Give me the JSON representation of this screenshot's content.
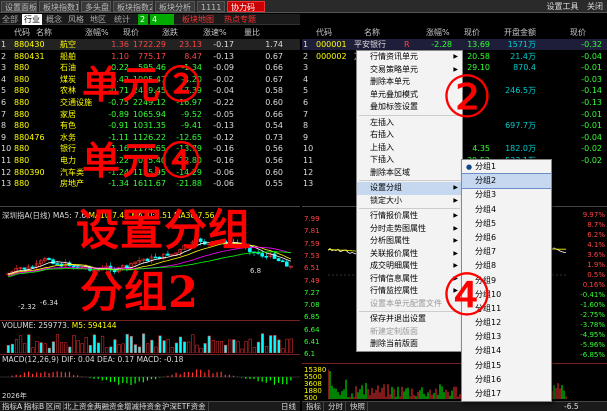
{
  "top_tabs": [
    "设置面板",
    "板块指数1",
    "多头盘",
    "板块指数2",
    "板块分析",
    "1111",
    "协力码"
  ],
  "top_right": [
    "设置工具",
    "关闭"
  ],
  "left_panel": {
    "tabs": [
      "全部",
      "行业",
      "概念",
      "风格",
      "地区",
      "统计"
    ],
    "selected_count": "2",
    "tab_extra": "4",
    "tab_map": "板块地图",
    "tab_hot": "热点专题",
    "headers": [
      "代码",
      "名称",
      "涨幅%",
      "现价",
      "涨跌",
      "涨速%",
      "量比"
    ],
    "rows": [
      {
        "idx": "1",
        "code": "880430",
        "name": "航空",
        "chg": "1.36",
        "price": "1722.29",
        "diff": "23.13",
        "speed": "-0.17",
        "vr": "1.74"
      },
      {
        "idx": "2",
        "code": "880431",
        "name": "船舶",
        "chg": "1.10",
        "price": "775.17",
        "diff": "8.47",
        "speed": "-0.13",
        "vr": "0.67"
      },
      {
        "idx": "3",
        "code": "880",
        "name": "石油",
        "chg": "-0.22",
        "price": "595.46",
        "diff": "-1.34",
        "speed": "-0.09",
        "vr": "0.66"
      },
      {
        "idx": "4",
        "code": "880",
        "name": "煤炭",
        "chg": "-0.42",
        "price": "1005.47",
        "diff": "-4.20",
        "speed": "-0.02",
        "vr": "0.67"
      },
      {
        "idx": "5",
        "code": "880",
        "name": "农林",
        "chg": "-0.71",
        "price": "2449.45",
        "diff": "-17.39",
        "speed": "-0.04",
        "vr": "0.58"
      },
      {
        "idx": "6",
        "code": "880",
        "name": "交通设施",
        "chg": "-0.75",
        "price": "2249.12",
        "diff": "-16.97",
        "speed": "-0.22",
        "vr": "0.60"
      },
      {
        "idx": "7",
        "code": "880",
        "name": "家居",
        "chg": "-0.89",
        "price": "1065.94",
        "diff": "-9.52",
        "speed": "-0.05",
        "vr": "0.66"
      },
      {
        "idx": "8",
        "code": "880",
        "name": "有色",
        "chg": "-0.91",
        "price": "1031.35",
        "diff": "-9.41",
        "speed": "-0.13",
        "vr": "0.54"
      },
      {
        "idx": "9",
        "code": "880476",
        "name": "水务",
        "chg": "-1.11",
        "price": "1126.22",
        "diff": "-12.65",
        "speed": "-0.12",
        "vr": "0.73"
      },
      {
        "idx": "10",
        "code": "880",
        "name": "银行",
        "chg": "-1.16",
        "price": "1174.65",
        "diff": "-13.79",
        "speed": "-0.16",
        "vr": "0.56"
      },
      {
        "idx": "11",
        "code": "880",
        "name": "电力",
        "chg": "-1.22",
        "price": "1035.40",
        "diff": "-12.80",
        "speed": "-0.16",
        "vr": "0.56"
      },
      {
        "idx": "12",
        "code": "880390",
        "name": "汽车类",
        "chg": "-1.24",
        "price": "1135.95",
        "diff": "-14.29",
        "speed": "-0.06",
        "vr": "0.60"
      },
      {
        "idx": "13",
        "code": "880",
        "name": "房地产",
        "chg": "-1.34",
        "price": "1611.67",
        "diff": "-21.88",
        "speed": "-0.06",
        "vr": "0.55"
      }
    ]
  },
  "right_panel": {
    "headers": [
      "代码",
      "名称",
      "",
      "涨幅%",
      "现价",
      "开盘金额",
      "现价"
    ],
    "rows": [
      {
        "idx": "1",
        "code": "000001",
        "name": "平安银行",
        "flag": "R",
        "chg": "-2.28",
        "price": "13.69",
        "amount": "1571万",
        "last": "-0.32"
      },
      {
        "idx": "2",
        "code": "000002",
        "name": "万科A",
        "flag": "",
        "chg": "-0.21",
        "price": "20.58",
        "amount": "21.4万",
        "last": "-0.04"
      },
      {
        "idx": "3",
        "code": "",
        "name": "",
        "flag": "",
        "chg": "",
        "price": "29.10",
        "amount": "870.4",
        "last": "-0.01"
      },
      {
        "idx": "4",
        "code": "",
        "name": "",
        "flag": "",
        "chg": "",
        "price": "",
        "amount": "",
        "last": "-0.03"
      },
      {
        "idx": "5",
        "code": "",
        "name": "",
        "flag": "",
        "chg": "",
        "price": "",
        "amount": "246.5万",
        "last": "-0.14"
      },
      {
        "idx": "6",
        "code": "",
        "name": "",
        "flag": "",
        "chg": "",
        "price": "",
        "amount": "",
        "last": "-0.13"
      },
      {
        "idx": "7",
        "code": "",
        "name": "",
        "flag": "",
        "chg": "",
        "price": "",
        "amount": "",
        "last": "-0.01"
      },
      {
        "idx": "8",
        "code": "",
        "name": "",
        "flag": "",
        "chg": "",
        "price": "",
        "amount": "697.7万",
        "last": "-0.01"
      },
      {
        "idx": "9",
        "code": "",
        "name": "",
        "flag": "",
        "chg": "",
        "price": "",
        "amount": "",
        "last": "-0.04"
      },
      {
        "idx": "10",
        "code": "",
        "name": "",
        "flag": "",
        "chg": "",
        "price": "4.35",
        "amount": "182.0万",
        "last": "-0.02"
      },
      {
        "idx": "11",
        "code": "",
        "name": "",
        "flag": "",
        "chg": "",
        "price": "29.52",
        "amount": "533.1万",
        "last": "-0.02"
      },
      {
        "idx": "12",
        "code": "",
        "name": "",
        "flag": "",
        "chg": "",
        "price": "",
        "amount": "",
        "last": ""
      },
      {
        "idx": "13",
        "code": "",
        "name": "",
        "flag": "",
        "chg": "",
        "price": "",
        "amount": "",
        "last": ""
      }
    ]
  },
  "left_chart": {
    "title": "深圳指A(日线)",
    "ma_label": "MA5:",
    "ma_val": "7.6",
    "ma_more": "MA10:7.49 MA20:7.51 MA30:7.56",
    "price_labels": [
      "-2.32",
      "-6.34",
      "6.8"
    ],
    "volume_label": "VOLUME: 259773.",
    "volume_more": "M5: 594144",
    "macd_label": "MACD(12,26,9) DIF: 0.04 DEA: 0.17 MACD: -0.18",
    "date": "2026年",
    "bottom_tabs": [
      "指标A",
      "指标B",
      "区间",
      "北上资金",
      "两融资金",
      "增减持资金",
      "沪深ETF资金"
    ],
    "bottom_right": "日线"
  },
  "right_chart": {
    "y_left": [
      "7.99",
      "7.81",
      "7.59",
      "7.53",
      "6.51",
      "7.49",
      "7.27",
      "7.08",
      "6.85",
      "6.64",
      "6.41",
      "6.1"
    ],
    "y_right": [
      "9.97%",
      "8.7%",
      "6.2%",
      "4.1%",
      "3.6%",
      "1.9%",
      "0.5%",
      "0.16%",
      "-0.41%",
      "-1.60%",
      "-2.75%",
      "-3.78%",
      "-4.95%",
      "-5.96%",
      "-6.85%"
    ],
    "vol_labels": [
      "15380",
      "5500",
      "3608",
      "1880",
      "500"
    ],
    "bottom_tabs": [
      "指标",
      "分时",
      "快照"
    ],
    "bottom_time": "-6.5"
  },
  "context_menu": {
    "items": [
      {
        "label": "行情资讯单元",
        "arrow": true,
        "disabled": false
      },
      {
        "label": "交易策略单元",
        "arrow": true,
        "disabled": false
      },
      {
        "label": "删除本单元",
        "arrow": false,
        "disabled": false
      },
      {
        "label": "单元叠加模式",
        "arrow": false,
        "disabled": false
      },
      {
        "label": "叠加标签设置",
        "arrow": false,
        "disabled": false
      },
      {
        "sep": true
      },
      {
        "label": "左插入",
        "arrow": false,
        "disabled": false
      },
      {
        "label": "右插入",
        "arrow": false,
        "disabled": false
      },
      {
        "label": "上插入",
        "arrow": false,
        "disabled": false
      },
      {
        "label": "下插入",
        "arrow": false,
        "disabled": false
      },
      {
        "label": "删除本区域",
        "arrow": false,
        "disabled": false
      },
      {
        "sep": true
      },
      {
        "label": "设置分组",
        "arrow": true,
        "disabled": false,
        "selected": true
      },
      {
        "label": "锁定大小",
        "arrow": true,
        "disabled": false
      },
      {
        "sep": true
      },
      {
        "label": "行情报价属性",
        "arrow": true,
        "disabled": false
      },
      {
        "label": "分时走势图属性",
        "arrow": true,
        "disabled": false
      },
      {
        "label": "分析图属性",
        "arrow": true,
        "disabled": false
      },
      {
        "label": "关联报价属性",
        "arrow": true,
        "disabled": false
      },
      {
        "label": "成交明细属性",
        "arrow": true,
        "disabled": false
      },
      {
        "label": "行情信息属性",
        "arrow": true,
        "disabled": false
      },
      {
        "label": "行情监控属性",
        "arrow": true,
        "disabled": false
      },
      {
        "label": "设置本单元配置文件",
        "arrow": false,
        "disabled": true
      },
      {
        "sep": true
      },
      {
        "label": "保存并退出设置",
        "arrow": false,
        "disabled": false
      },
      {
        "label": "新建定制版面",
        "arrow": false,
        "disabled": true
      },
      {
        "label": "删除当前版面",
        "arrow": false,
        "disabled": false
      }
    ]
  },
  "submenu": {
    "items": [
      "分组1",
      "分组2",
      "分组3",
      "分组4",
      "分组5",
      "分组6",
      "分组7",
      "分组8",
      "分组9",
      "分组10",
      "分组11",
      "分组12",
      "分组13",
      "分组14",
      "分组15",
      "分组16",
      "分组17"
    ],
    "checked_index": 0,
    "hover_index": 1
  },
  "overlays": {
    "unit2": "单元②",
    "unit4": "单元④",
    "set_group": "设置分组",
    "group2": "分组2",
    "circle2": "②",
    "circle4": "④"
  },
  "colors": {
    "up": "#ff4444",
    "down": "#33ff33",
    "code": "#ffff00",
    "annot": "#ff0000",
    "tab_active": "#cc0000"
  }
}
